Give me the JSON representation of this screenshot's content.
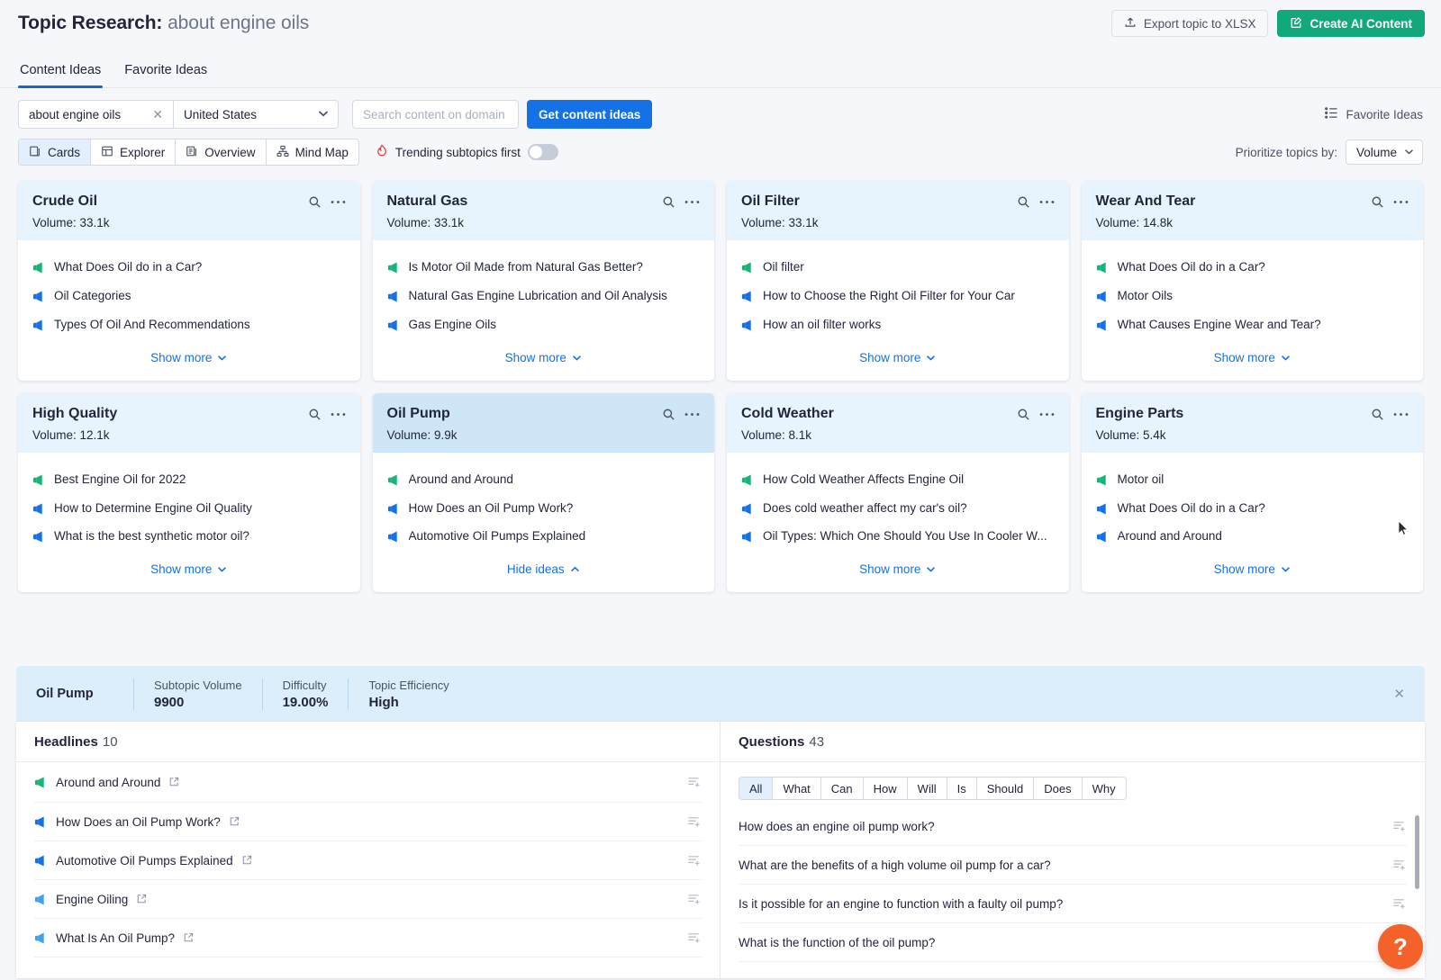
{
  "header": {
    "title_prefix": "Topic Research:",
    "title_keyword": "about engine oils",
    "export_label": "Export topic to XLSX",
    "export_icon": "upload-icon",
    "ai_label": "Create AI Content",
    "ai_icon": "edit-square-icon"
  },
  "tabs": [
    {
      "label": "Content Ideas",
      "active": true
    },
    {
      "label": "Favorite Ideas",
      "active": false
    }
  ],
  "filters": {
    "keyword_value": "about engine oils",
    "clear_icon": "close-icon",
    "database_value": "United States",
    "domain_placeholder": "Search content on domain",
    "domain_value": "",
    "get_ideas_label": "Get content ideas",
    "favorite_ideas_label": "Favorite Ideas",
    "favorite_icon": "list-icon"
  },
  "viewbar": {
    "views": [
      {
        "label": "Cards",
        "icon": "cards-icon",
        "active": true
      },
      {
        "label": "Explorer",
        "icon": "table-icon",
        "active": false
      },
      {
        "label": "Overview",
        "icon": "overview-icon",
        "active": false
      },
      {
        "label": "Mind Map",
        "icon": "mindmap-icon",
        "active": false
      }
    ],
    "trending_label": "Trending subtopics first",
    "trending_icon": "flame-icon",
    "trending_on": false,
    "prioritize_label": "Prioritize topics by:",
    "prioritize_value": "Volume"
  },
  "cards": [
    {
      "title": "Crude Oil",
      "volume_label": "Volume: 33.1k",
      "selected": false,
      "ideas": [
        {
          "text": "What Does Oil do in a Car?",
          "color": "green"
        },
        {
          "text": "Oil Categories",
          "color": "blue"
        },
        {
          "text": "Types Of Oil And Recommendations",
          "color": "blue"
        }
      ],
      "footer_label": "Show more",
      "footer_state": "collapsed"
    },
    {
      "title": "Natural Gas",
      "volume_label": "Volume: 33.1k",
      "selected": false,
      "ideas": [
        {
          "text": "Is Motor Oil Made from Natural Gas Better?",
          "color": "green"
        },
        {
          "text": "Natural Gas Engine Lubrication and Oil Analysis",
          "color": "blue"
        },
        {
          "text": "Gas Engine Oils",
          "color": "blue"
        }
      ],
      "footer_label": "Show more",
      "footer_state": "collapsed"
    },
    {
      "title": "Oil Filter",
      "volume_label": "Volume: 33.1k",
      "selected": false,
      "ideas": [
        {
          "text": "Oil filter",
          "color": "green"
        },
        {
          "text": "How to Choose the Right Oil Filter for Your Car",
          "color": "blue"
        },
        {
          "text": "How an oil filter works",
          "color": "blue"
        }
      ],
      "footer_label": "Show more",
      "footer_state": "collapsed"
    },
    {
      "title": "Wear And Tear",
      "volume_label": "Volume: 14.8k",
      "selected": false,
      "ideas": [
        {
          "text": "What Does Oil do in a Car?",
          "color": "green"
        },
        {
          "text": "Motor Oils",
          "color": "blue"
        },
        {
          "text": "What Causes Engine Wear and Tear?",
          "color": "blue"
        }
      ],
      "footer_label": "Show more",
      "footer_state": "collapsed"
    },
    {
      "title": "High Quality",
      "volume_label": "Volume: 12.1k",
      "selected": false,
      "ideas": [
        {
          "text": "Best Engine Oil for 2022",
          "color": "green"
        },
        {
          "text": "How to Determine Engine Oil Quality",
          "color": "blue"
        },
        {
          "text": "What is the best synthetic motor oil?",
          "color": "blue"
        }
      ],
      "footer_label": "Show more",
      "footer_state": "collapsed"
    },
    {
      "title": "Oil Pump",
      "volume_label": "Volume: 9.9k",
      "selected": true,
      "ideas": [
        {
          "text": "Around and Around",
          "color": "green"
        },
        {
          "text": "How Does an Oil Pump Work?",
          "color": "blue"
        },
        {
          "text": "Automotive Oil Pumps Explained",
          "color": "blue"
        }
      ],
      "footer_label": "Hide ideas",
      "footer_state": "expanded"
    },
    {
      "title": "Cold Weather",
      "volume_label": "Volume: 8.1k",
      "selected": false,
      "ideas": [
        {
          "text": "How Cold Weather Affects Engine Oil",
          "color": "green"
        },
        {
          "text": "Does cold weather affect my car's oil?",
          "color": "blue"
        },
        {
          "text": "Oil Types: Which One Should You Use In Cooler W...",
          "color": "blue"
        }
      ],
      "footer_label": "Show more",
      "footer_state": "collapsed"
    },
    {
      "title": "Engine Parts",
      "volume_label": "Volume: 5.4k",
      "selected": false,
      "ideas": [
        {
          "text": "Motor oil",
          "color": "green"
        },
        {
          "text": "What Does Oil do in a Car?",
          "color": "blue"
        },
        {
          "text": "Around and Around",
          "color": "blue"
        }
      ],
      "footer_label": "Show more",
      "footer_state": "collapsed"
    }
  ],
  "detail": {
    "subtopic_name": "Oil Pump",
    "metrics": [
      {
        "label": "Subtopic Volume",
        "value": "9900"
      },
      {
        "label": "Difficulty",
        "value": "19.00%"
      },
      {
        "label": "Topic Efficiency",
        "value": "High"
      }
    ],
    "close_icon": "close-icon"
  },
  "headlines_panel": {
    "title": "Headlines",
    "count": "10",
    "items": [
      {
        "text": "Around and Around",
        "color": "green"
      },
      {
        "text": "How Does an Oil Pump Work?",
        "color": "blue"
      },
      {
        "text": "Automotive Oil Pumps Explained",
        "color": "blue"
      },
      {
        "text": "Engine Oiling",
        "color": "lightblue"
      },
      {
        "text": "What Is An Oil Pump?",
        "color": "lightblue"
      }
    ],
    "external_icon": "external-link-icon",
    "add_icon": "add-to-list-icon"
  },
  "questions_panel": {
    "title": "Questions",
    "count": "43",
    "filters": [
      {
        "label": "All",
        "active": true
      },
      {
        "label": "What",
        "active": false
      },
      {
        "label": "Can",
        "active": false
      },
      {
        "label": "How",
        "active": false
      },
      {
        "label": "Will",
        "active": false
      },
      {
        "label": "Is",
        "active": false
      },
      {
        "label": "Should",
        "active": false
      },
      {
        "label": "Does",
        "active": false
      },
      {
        "label": "Why",
        "active": false
      }
    ],
    "items": [
      {
        "text": "How does an engine oil pump work?"
      },
      {
        "text": "What are the benefits of a high volume oil pump for a car?"
      },
      {
        "text": "Is it possible for an engine to function with a faulty oil pump?"
      },
      {
        "text": "What is the function of the oil pump?"
      }
    ],
    "add_icon": "add-to-list-icon"
  },
  "help": {
    "label": "?",
    "icon": "question-mark-icon"
  },
  "colors": {
    "accent_blue": "#1472e6",
    "green": "#12a87c",
    "card_header": "#e8f4fd",
    "card_header_selected": "#cfe5f8",
    "help_orange": "#f4622a"
  }
}
